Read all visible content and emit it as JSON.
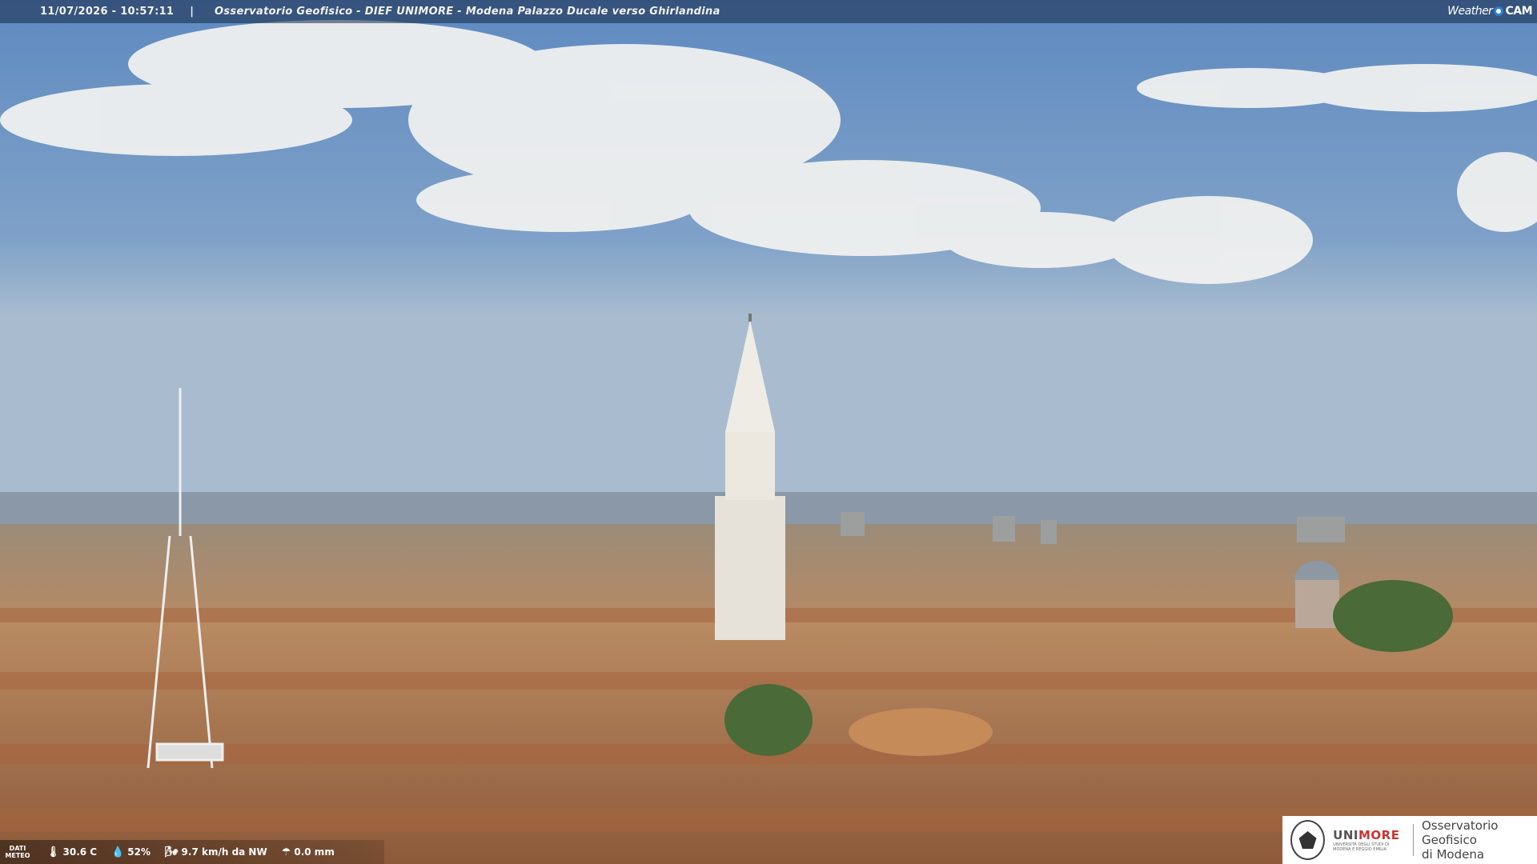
{
  "header": {
    "timestamp": "11/07/2026 - 10:57:11",
    "separator": "|",
    "title": "Osservatorio Geofisico - DIEF UNIMORE - Modena Palazzo Ducale verso Ghirlandina"
  },
  "brand": {
    "weather": "Weather",
    "cam": "CAM",
    "accent": "#2a7fd0"
  },
  "meteo": {
    "label": "DATI METEO",
    "temperature": "30.6 C",
    "humidity": "52%",
    "wind": "9.7 km/h da NW",
    "rain": "0.0 mm"
  },
  "logo": {
    "uni_main_a": "UNI",
    "uni_main_b": "MORE",
    "uni_sub": "UNIVERSITÀ DEGLI STUDI DI MODENA E REGGIO EMILIA",
    "obs_line1": "Osservatorio Geofisico",
    "obs_line2": "di Modena"
  },
  "scene": {
    "sky": "#7d9ec7",
    "roof": "#b57b55",
    "tower": "#e8e4dc"
  }
}
